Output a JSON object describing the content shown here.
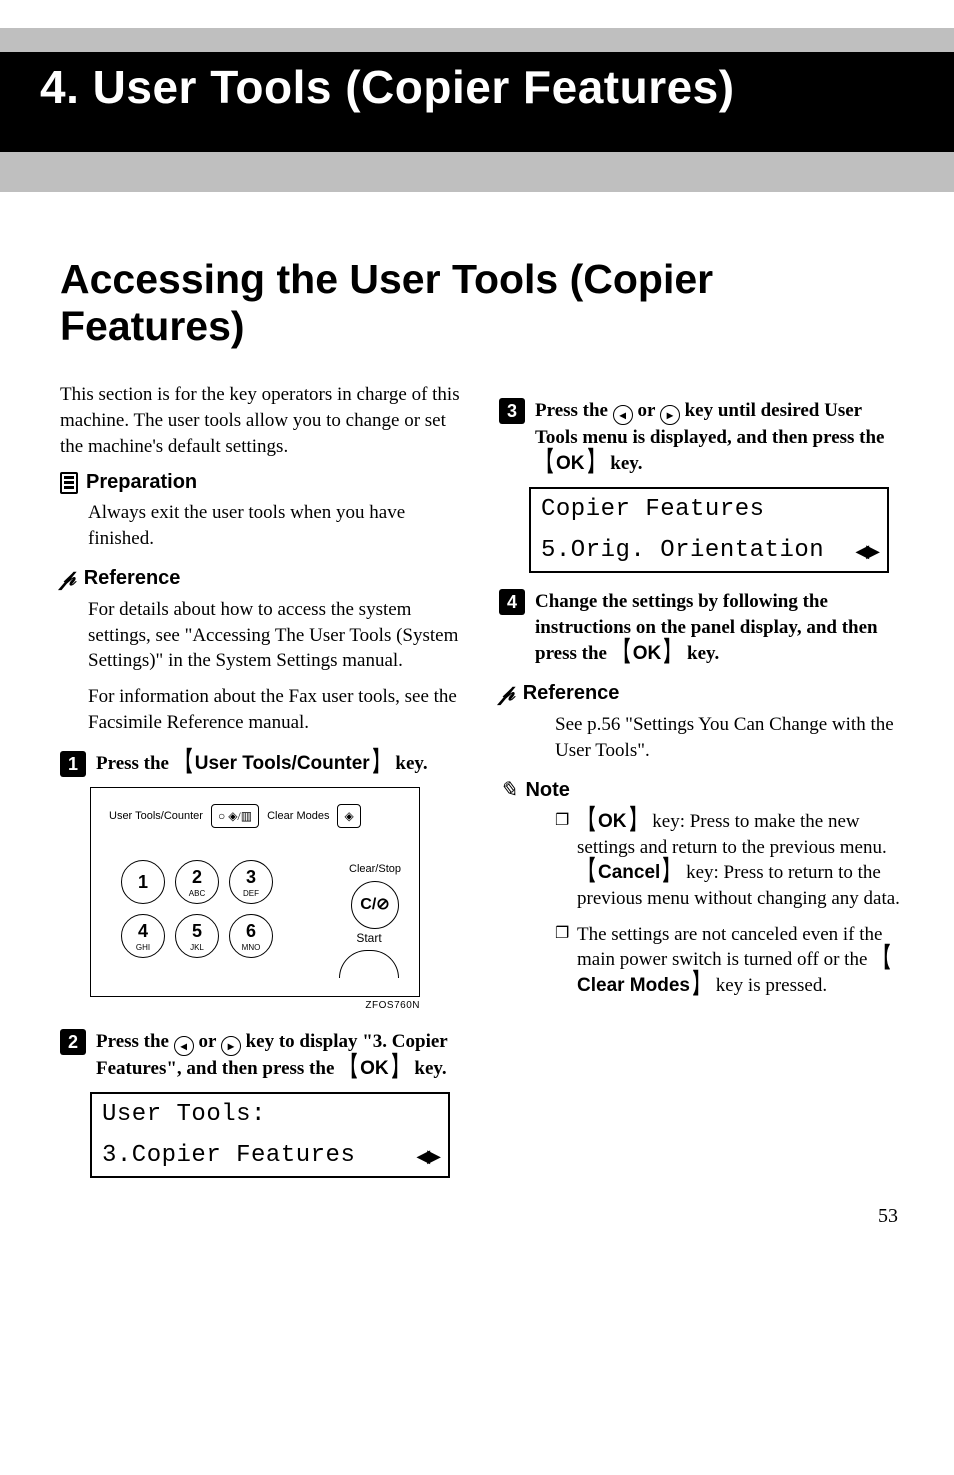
{
  "chapter": {
    "title": "4. User Tools (Copier Features)"
  },
  "section": {
    "title": "Accessing the User Tools (Copier Features)"
  },
  "left": {
    "intro": "This section is for the key operators in charge of this machine. The user tools allow you to change or set the machine's default settings.",
    "prep_label": "Preparation",
    "prep_text": "Always exit the user tools when you have finished.",
    "ref_label": "Reference",
    "ref_text1": "For details about how to access the system settings, see \"Accessing The User Tools (System Settings)\" in the System Settings manual.",
    "ref_text2": "For information about the Fax user tools, see the Facsimile Reference manual.",
    "step1_num": "1",
    "step1_pre": "Press the ",
    "step1_key": "User Tools/Counter",
    "step1_post": " key.",
    "fig": {
      "ut_label": "User Tools/Counter",
      "clear_modes": "Clear Modes",
      "k1": "1",
      "k2": "2",
      "k2s": "ABC",
      "k3": "3",
      "k3s": "DEF",
      "k4": "4",
      "k4s": "GHI",
      "k5": "5",
      "k5s": "JKL",
      "k6": "6",
      "k6s": "MNO",
      "clearstop": "Clear/Stop",
      "cs_btn": "C/",
      "start": "Start",
      "code": "ZFOS760N"
    },
    "step2_num": "2",
    "step2_a": "Press the ",
    "step2_b": " or ",
    "step2_c": " key to display \"3. Copier Features\", and then press the ",
    "step2_key": "OK",
    "step2_d": " key.",
    "lcd1_line1": "User Tools:",
    "lcd1_line2": "3.Copier Features"
  },
  "right": {
    "step3_num": "3",
    "step3_a": "Press the ",
    "step3_b": " or ",
    "step3_c": " key until desired User Tools menu is displayed, and then press the ",
    "step3_key": "OK",
    "step3_d": " key.",
    "lcd2_line1": "Copier Features",
    "lcd2_line2": "5.Orig. Orientation",
    "step4_num": "4",
    "step4_a": "Change the settings by following the instructions on the panel display, and then press the ",
    "step4_key": "OK",
    "step4_b": " key.",
    "ref_label": "Reference",
    "ref_text": "See p.56 \"Settings You Can Change with the User Tools\".",
    "note_label": "Note",
    "note1_key1": "OK",
    "note1_a": " key: Press to make the new settings and return to the previous menu. ",
    "note1_key2": "Cancel",
    "note1_b": " key: Press to return to the previous menu without changing any data.",
    "note2_a": "The settings are not canceled even if the main power switch is turned off or the ",
    "note2_key": "Clear Modes",
    "note2_b": " key is pressed."
  },
  "page_number": "53"
}
